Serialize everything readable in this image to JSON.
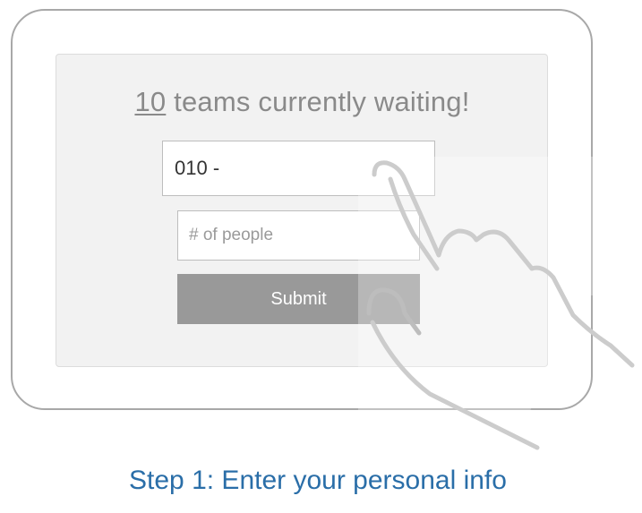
{
  "headline": {
    "count": "10",
    "text": " teams currently waiting!"
  },
  "form": {
    "phone_value": "010 -",
    "people_placeholder": "# of people",
    "submit_label": "Submit"
  },
  "caption": "Step 1: Enter your personal info",
  "colors": {
    "caption": "#2a6ea8",
    "submit_bg": "#999999",
    "headline": "#8a8a8a"
  },
  "icons": {
    "hand": "pointing-hand-icon"
  }
}
